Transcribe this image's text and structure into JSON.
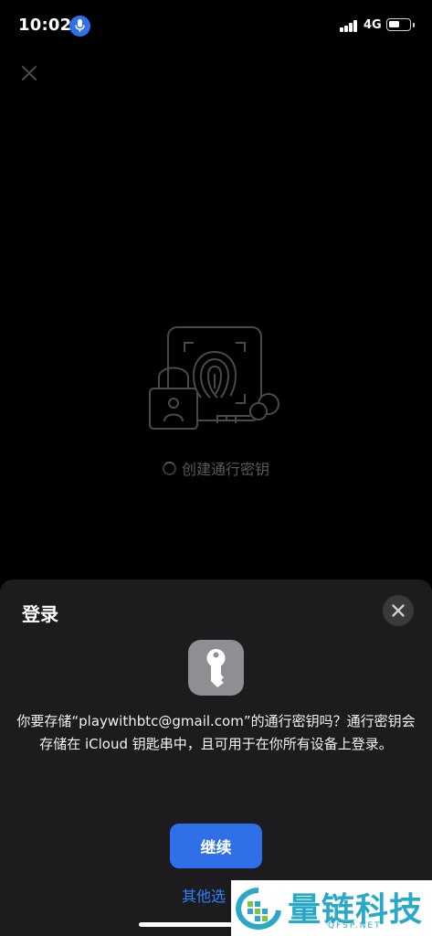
{
  "status_bar": {
    "time": "10:02",
    "network": "4G",
    "icons": [
      "microphone-icon",
      "signal-bars-icon",
      "battery-icon"
    ],
    "accent_color": "#2f6fe8"
  },
  "background": {
    "close_icon": "close-icon",
    "hero_icon": "passkey-illustration",
    "status_text": "创建通行密钥"
  },
  "sheet": {
    "title": "登录",
    "close_icon": "close-icon",
    "app_icon": "key-icon",
    "message": "你要存储“playwithbtc@gmail.com”的通行密钥吗？通行密钥会存储在 iCloud 钥匙串中，且可用于在你所有设备上登录。",
    "primary_button": "继续",
    "secondary_link": "其他选",
    "colors": {
      "sheet_bg": "#1c1c1e",
      "button_bg": "#2f6fe8",
      "link": "#2f80ff"
    }
  },
  "watermark": {
    "name": "量链科技",
    "domain": "QFSP.NET"
  }
}
